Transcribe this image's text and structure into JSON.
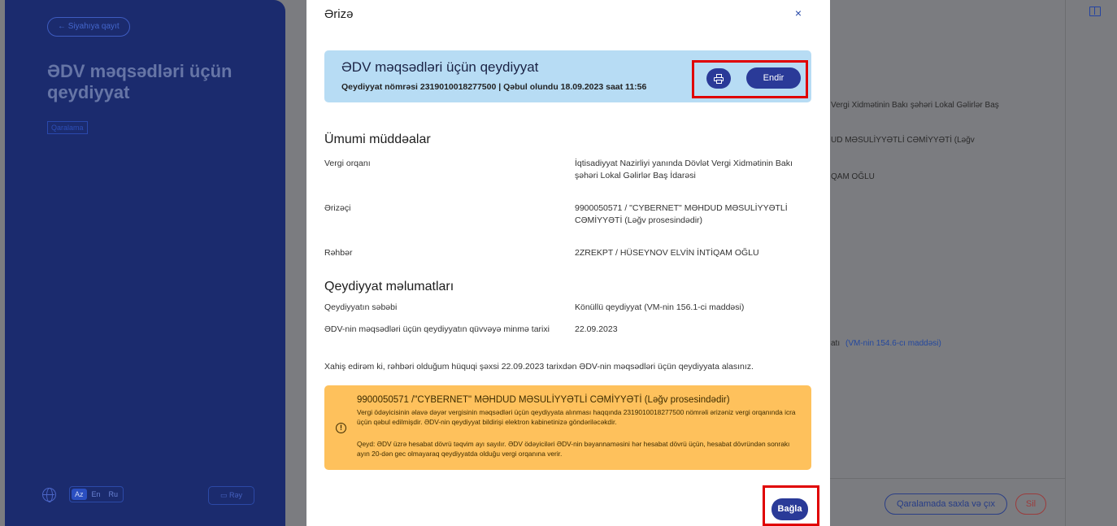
{
  "background": {
    "back_label": "← Siyahıya qayıt",
    "page_title": "ƏDV məqsədləri üçün qeydiyyat",
    "draft_badge": "Qaralama",
    "languages": [
      "Az",
      "En",
      "Ru"
    ],
    "feedback_label": "Rəy",
    "right_texts": {
      "tax_office": "Vergi Xidmətinin Bakı şəhəri Lokal Gəlirlər Baş",
      "company": "UD MƏSULİYYƏTLİ CƏMİYYƏTİ (Ləğv",
      "head": "QAM OĞLU",
      "article_prefix": "atı",
      "article_link": "(VM-nin 154.6-cı maddəsi)"
    },
    "save_draft_exit_label": "Qaralamada saxla və çıx",
    "delete_label": "Sil"
  },
  "modal": {
    "title": "Ərizə",
    "close_symbol": "×",
    "header": {
      "title": "ƏDV məqsədləri üçün qeydiyyat",
      "subtitle": "Qeydiyyat nömrəsi 2319010018277500 | Qəbul olundu 18.09.2023 saat 11:56",
      "download_label": "Endir"
    },
    "general_section": {
      "title": "Ümumi müddəalar",
      "fields": [
        {
          "label": "Vergi orqanı",
          "value": "İqtisadiyyat Nazirliyi yanında Dövlət Vergi Xidmətinin Bakı şəhəri Lokal Gəlirlər Baş İdarəsi"
        },
        {
          "label": "Ərizəçi",
          "value": "9900050571 / \"CYBERNET\" MƏHDUD MƏSULİYYƏTLİ CƏMİYYƏTİ (Ləğv prosesindədir)"
        },
        {
          "label": "Rəhbər",
          "value": "2ZREKPT / HÜSEYNOV ELVİN İNTİQAM OĞLU"
        }
      ]
    },
    "registration_section": {
      "title": "Qeydiyyat məlumatları",
      "fields": [
        {
          "label": "Qeydiyyatın səbəbi",
          "value": "Könüllü qeydiyyat (VM-nin 156.1-ci maddəsi)"
        },
        {
          "label": "ƏDV-nin məqsədləri üçün qeydiyyatın qüvvəyə minmə tarixi",
          "value": "22.09.2023"
        }
      ]
    },
    "request_text": "Xahiş edirəm ki, rəhbəri olduğum hüquqi şəxsi 22.09.2023 tarixdən ƏDV-nin məqsədləri üçün qeydiyyata alasınız.",
    "info": {
      "icon": "!",
      "title": "9900050571 /\"CYBERNET\" MƏHDUD MƏSULİYYƏTLİ CƏMİYYƏTİ (Ləğv prosesindədir)",
      "message": "Vergi ödəyicisinin əlavə dəyər vergisinin məqsədləri üçün qeydiyyata alınması haqqında 2319010018277500 nömrəli ərizəniz vergi orqanında icra üçün qəbul edilmişdir. ƏDV-nin qeydiyyat bildirişi elektron kabinetinizə göndəriləcəkdir.",
      "note": "Qeyd: ƏDV üzrə hesabat dövrü təqvim ayı sayılır. ƏDV ödəyiciləri ƏDV-nin bəyannaməsini hər hesabat dövrü üçün, hesabat dövründən sonrakı ayın 20-dən gec olmayaraq qeydiyyatda olduğu vergi orqanına verir."
    },
    "close_button_label": "Bağla"
  },
  "colors": {
    "primary": "#2a3a98",
    "header_card_bg": "#b7dcf4",
    "info_bg": "#fec15c",
    "highlight": "#e00000",
    "sidebar_bg": "#1b2b6e"
  }
}
